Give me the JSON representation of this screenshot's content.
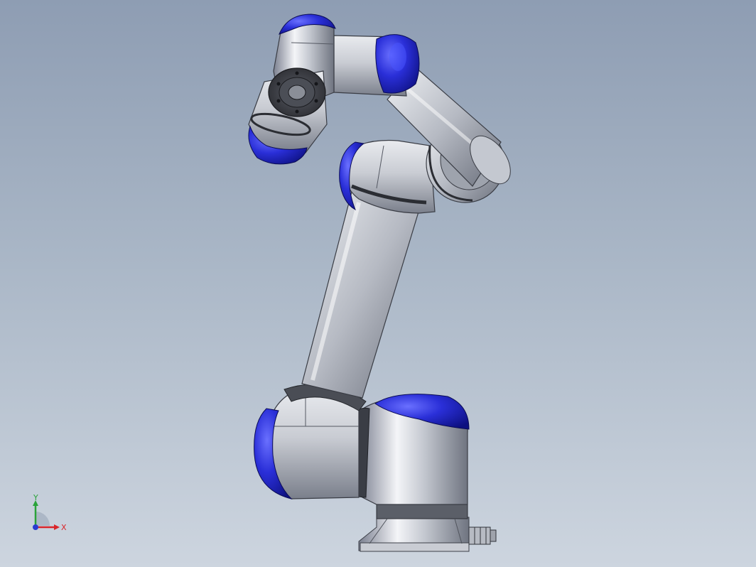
{
  "viewport": {
    "background_top": "#8e9db3",
    "background_bottom": "#cdd5df"
  },
  "model": {
    "name": "robot-arm-6-axis",
    "colors": {
      "body_light": "#f2f4f7",
      "body_mid": "#b9bdc6",
      "body_dark": "#6e7380",
      "cap_blue": "#2a2fd8",
      "cap_blue_dark": "#10148a",
      "flange_dark": "#3a3c42",
      "ring_accent": "#2f7fd6"
    }
  },
  "triad": {
    "x_label": "X",
    "y_label": "Y",
    "x_color": "#d9252a",
    "y_color": "#2aa33a",
    "z_color": "#2a3bd0"
  }
}
